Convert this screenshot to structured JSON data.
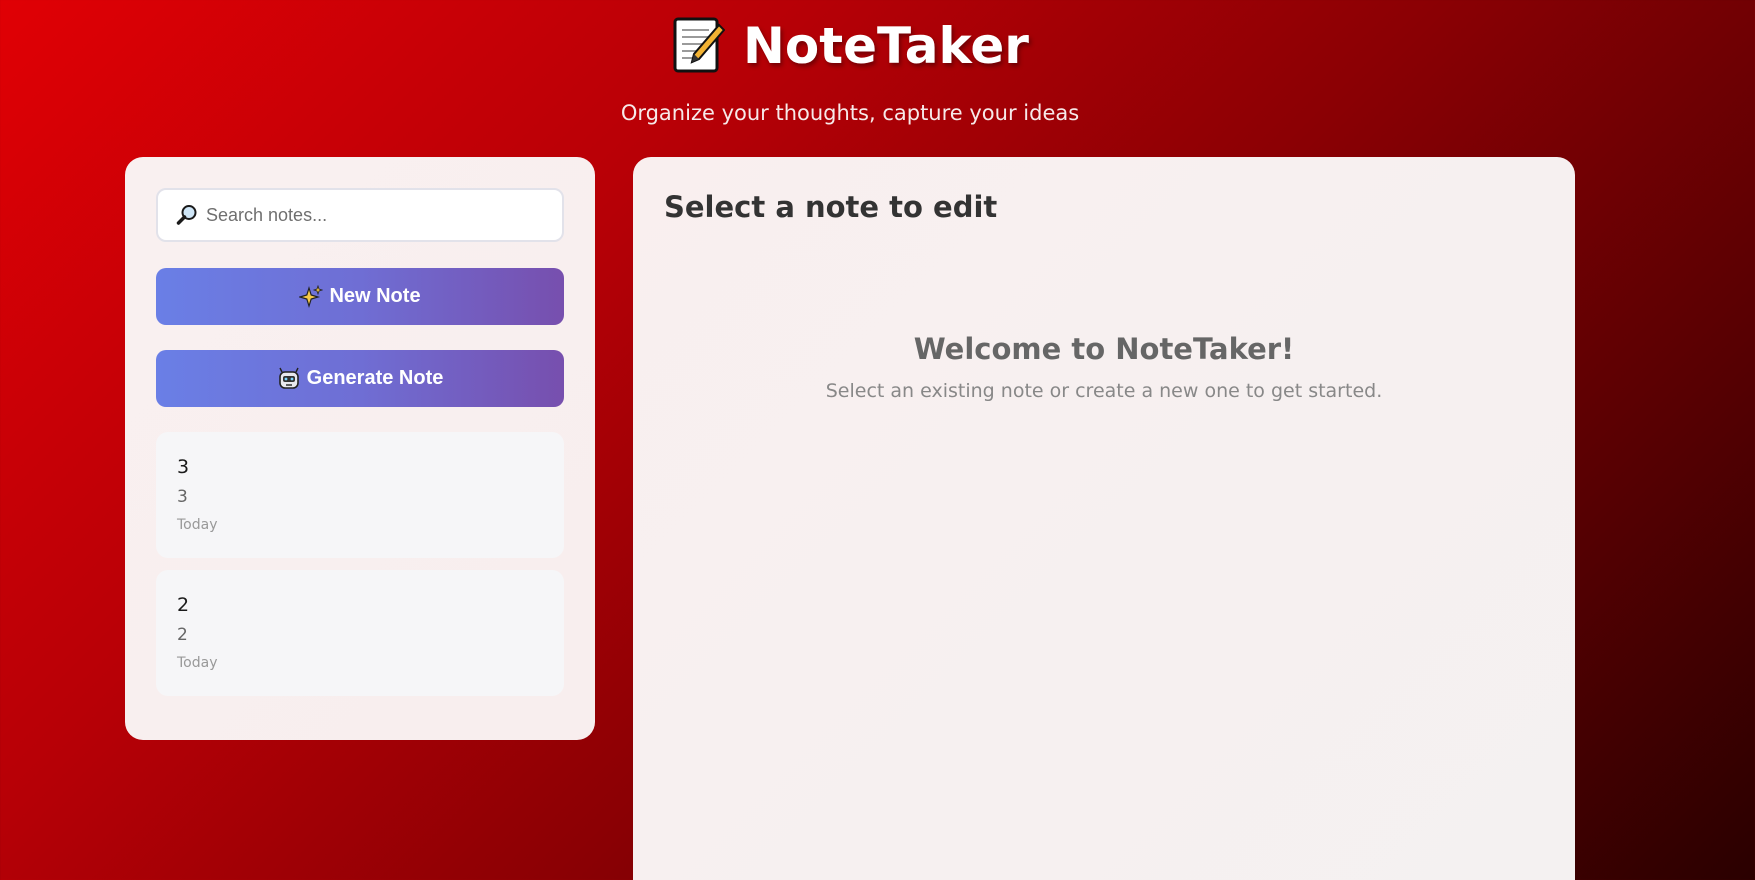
{
  "header": {
    "title": "NoteTaker",
    "title_icon": "memo-icon",
    "subtitle": "Organize your thoughts, capture your ideas"
  },
  "sidebar": {
    "search": {
      "icon": "magnifier-icon",
      "placeholder": "Search notes...",
      "value": ""
    },
    "new_note_button": {
      "icon": "sparkles-icon",
      "label": "New Note"
    },
    "generate_note_button": {
      "icon": "robot-icon",
      "label": "Generate Note"
    },
    "notes": [
      {
        "title": "3",
        "preview": "3",
        "date": "Today"
      },
      {
        "title": "2",
        "preview": "2",
        "date": "Today"
      }
    ]
  },
  "editor": {
    "heading": "Select a note to edit",
    "welcome_title": "Welcome to NoteTaker!",
    "welcome_text": "Select an existing note or create a new one to get started."
  },
  "colors": {
    "background_start": "#e00005",
    "background_end": "#2a0000",
    "button_gradient_start": "#6a7fe6",
    "button_gradient_end": "#774fae",
    "panel": "#f9f0f0"
  }
}
